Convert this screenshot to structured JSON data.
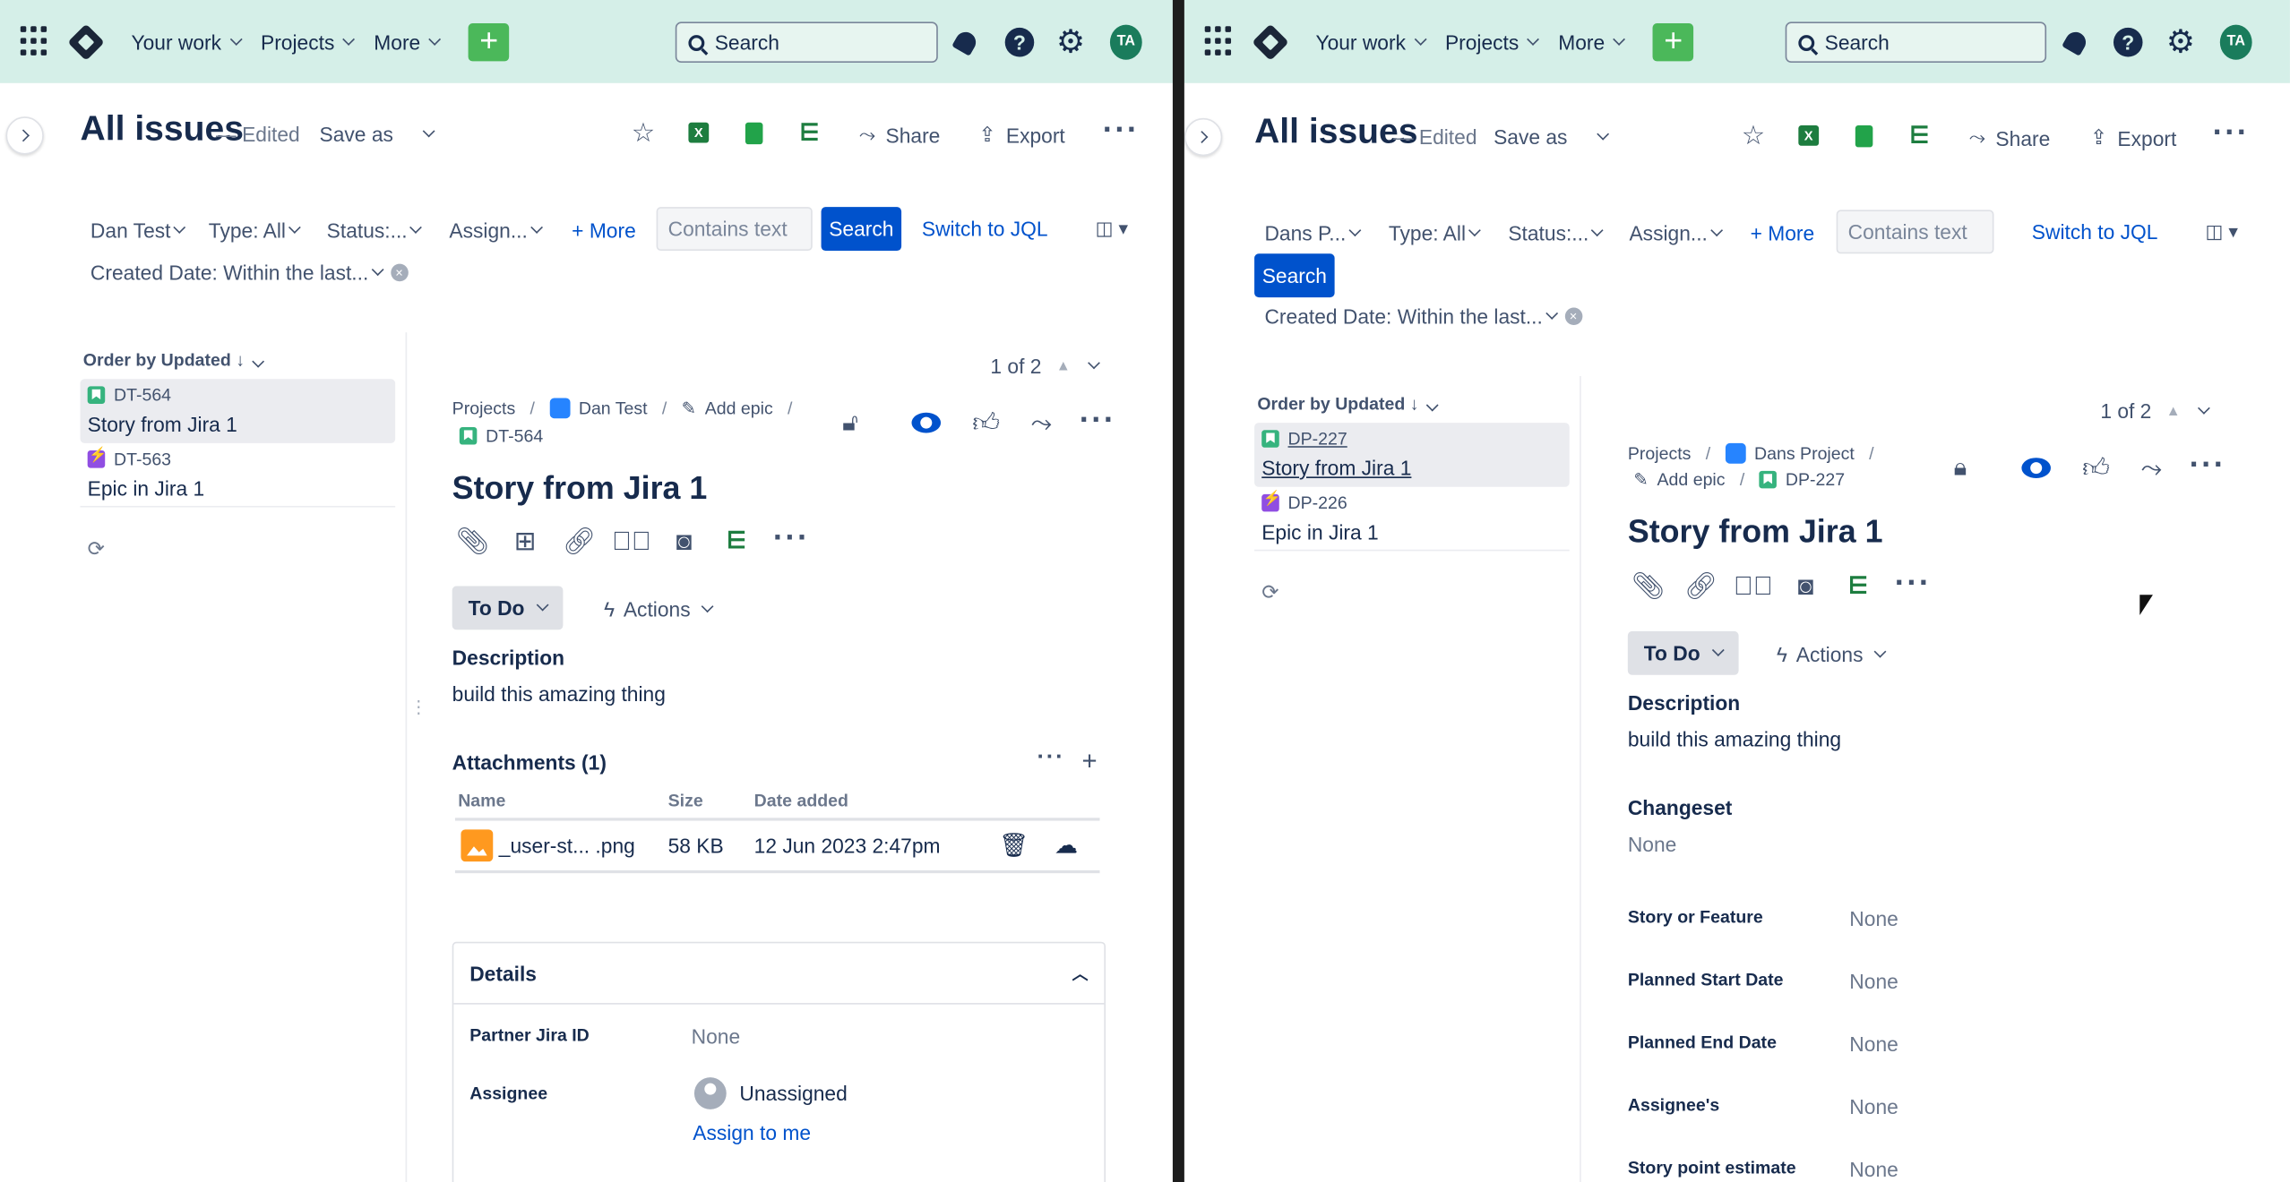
{
  "left": {
    "nav": {
      "items": [
        "Your work",
        "Projects",
        "More"
      ],
      "search_label": "Search",
      "avatar": "TA"
    },
    "header": {
      "title": "All issues",
      "edited": "— Edited",
      "save_as": "Save as",
      "share": "Share",
      "export": "Export"
    },
    "filters": {
      "project": "Dan Test",
      "type": "Type: All",
      "status": "Status:...",
      "assignee": "Assign...",
      "more": "+ More",
      "text_placeholder": "Contains text",
      "search_button": "Search",
      "switch_jql": "Switch to JQL",
      "created": "Created Date: Within the last..."
    },
    "list": {
      "order": "Order by Updated",
      "items": [
        {
          "key": "DT-564",
          "summary": "Story from Jira 1",
          "type": "story"
        },
        {
          "key": "DT-563",
          "summary": "Epic in Jira 1",
          "type": "epic"
        }
      ]
    },
    "issue": {
      "pager": "1 of 2",
      "breadcrumbs": {
        "projects": "Projects",
        "project": "Dan Test",
        "add_epic": "Add epic",
        "key": "DT-564"
      },
      "title": "Story from Jira 1",
      "status": "To Do",
      "actions": "Actions",
      "description_label": "Description",
      "description": "build this amazing thing",
      "attachments": {
        "title": "Attachments (1)",
        "headers": [
          "Name",
          "Size",
          "Date added"
        ],
        "rows": [
          {
            "name": "_user-st... .png",
            "size": "58 KB",
            "date": "12 Jun 2023 2:47pm"
          }
        ]
      },
      "details": {
        "title": "Details",
        "fields": [
          {
            "label": "Partner Jira ID",
            "value": "None"
          },
          {
            "label": "Assignee",
            "value": "Unassigned"
          }
        ],
        "assign_to_me": "Assign to me"
      }
    }
  },
  "right": {
    "nav": {
      "items": [
        "Your work",
        "Projects",
        "More"
      ],
      "search_label": "Search",
      "avatar": "TA"
    },
    "header": {
      "title": "All issues",
      "edited": "— Edited",
      "save_as": "Save as",
      "share": "Share",
      "export": "Export"
    },
    "filters": {
      "project": "Dans P...",
      "type": "Type: All",
      "status": "Status:...",
      "assignee": "Assign...",
      "more": "+ More",
      "text_placeholder": "Contains text",
      "search_button": "Search",
      "switch_jql": "Switch to JQL",
      "created": "Created Date: Within the last..."
    },
    "list": {
      "order": "Order by Updated",
      "items": [
        {
          "key": "DP-227",
          "summary": "Story from Jira 1",
          "type": "story"
        },
        {
          "key": "DP-226",
          "summary": "Epic in Jira 1",
          "type": "epic"
        }
      ]
    },
    "issue": {
      "pager": "1 of 2",
      "breadcrumbs": {
        "projects": "Projects",
        "project": "Dans Project",
        "add_epic": "Add epic",
        "key": "DP-227"
      },
      "title": "Story from Jira 1",
      "status": "To Do",
      "actions": "Actions",
      "description_label": "Description",
      "description": "build this amazing thing",
      "changeset_label": "Changeset",
      "changeset": "None",
      "fields": [
        {
          "label": "Story or Feature",
          "value": "None"
        },
        {
          "label": "Planned Start Date",
          "value": "None"
        },
        {
          "label": "Planned End Date",
          "value": "None"
        },
        {
          "label": "Assignee's",
          "value": "None"
        },
        {
          "label": "Story point estimate",
          "value": "None"
        }
      ]
    }
  },
  "colors": {
    "nav_bg": "#d5efe8",
    "primary": "#0052cc",
    "create": "#4bb85a",
    "story": "#36b37e",
    "epic": "#904ee2",
    "attachment": "#ff991f"
  }
}
